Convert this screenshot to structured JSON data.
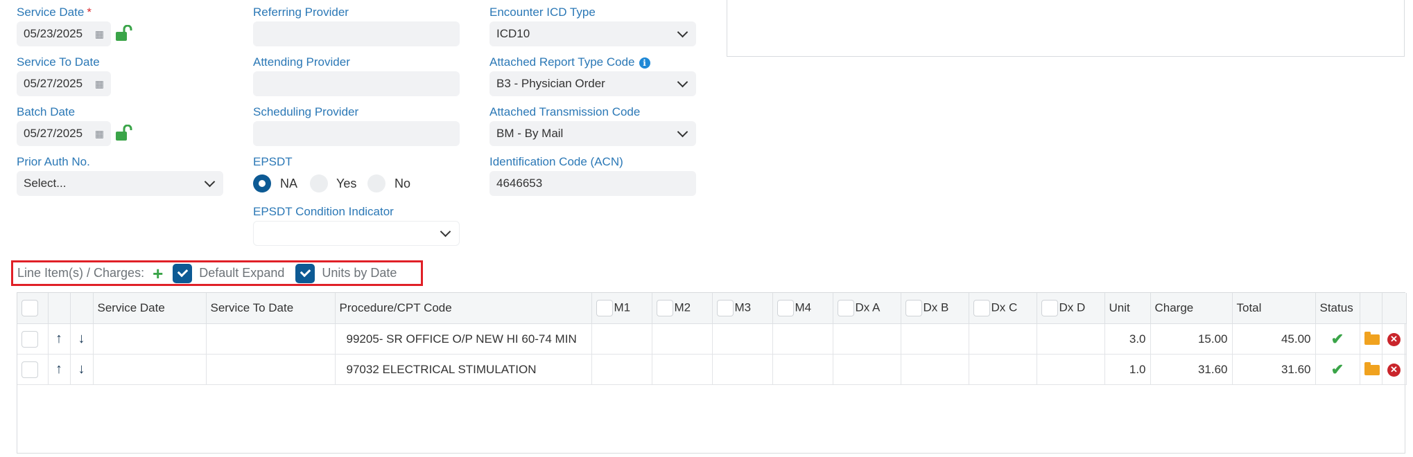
{
  "form": {
    "service_date": {
      "label": "Service Date",
      "required_mark": "*",
      "value": "05/23/2025"
    },
    "service_to_date": {
      "label": "Service To Date",
      "value": "05/27/2025"
    },
    "batch_date": {
      "label": "Batch Date",
      "value": "05/27/2025"
    },
    "prior_auth": {
      "label": "Prior Auth No.",
      "value": "Select..."
    },
    "referring_provider": {
      "label": "Referring Provider",
      "value": ""
    },
    "attending_provider": {
      "label": "Attending Provider",
      "value": ""
    },
    "scheduling_provider": {
      "label": "Scheduling Provider",
      "value": ""
    },
    "epsdt": {
      "label": "EPSDT",
      "options": [
        "NA",
        "Yes",
        "No"
      ],
      "selected": "NA"
    },
    "epsdt_condition": {
      "label": "EPSDT Condition Indicator",
      "value": ""
    },
    "encounter_icd_type": {
      "label": "Encounter ICD Type",
      "value": "ICD10"
    },
    "attached_report_type": {
      "label": "Attached Report Type Code",
      "value": "B3 - Physician Order"
    },
    "attached_transmission": {
      "label": "Attached Transmission Code",
      "value": "BM - By Mail"
    },
    "identification_code": {
      "label": "Identification Code (ACN)",
      "value": "4646653"
    }
  },
  "line_items": {
    "label": "Line Item(s) / Charges:",
    "default_expand": {
      "label": "Default Expand",
      "checked": true
    },
    "units_by_date": {
      "label": "Units by Date",
      "checked": true
    }
  },
  "table": {
    "headers": {
      "service_date": "Service Date",
      "service_to_date": "Service To Date",
      "procedure": "Procedure/CPT Code",
      "m1": "M1",
      "m2": "M2",
      "m3": "M3",
      "m4": "M4",
      "dxa": "Dx A",
      "dxb": "Dx B",
      "dxc": "Dx C",
      "dxd": "Dx D",
      "unit": "Unit",
      "charge": "Charge",
      "total": "Total",
      "status": "Status"
    },
    "rows": [
      {
        "service_date": "",
        "service_to_date": "",
        "procedure": "99205- SR OFFICE O/P NEW HI 60-74 MIN",
        "unit": "3.0",
        "charge": "15.00",
        "total": "45.00"
      },
      {
        "service_date": "",
        "service_to_date": "",
        "procedure": "97032 ELECTRICAL STIMULATION",
        "unit": "1.0",
        "charge": "31.60",
        "total": "31.60"
      }
    ]
  },
  "colors": {
    "label_blue": "#2b78b6",
    "primary": "#0d5a94",
    "highlight_red": "#e02027",
    "success_green": "#3aa448"
  }
}
